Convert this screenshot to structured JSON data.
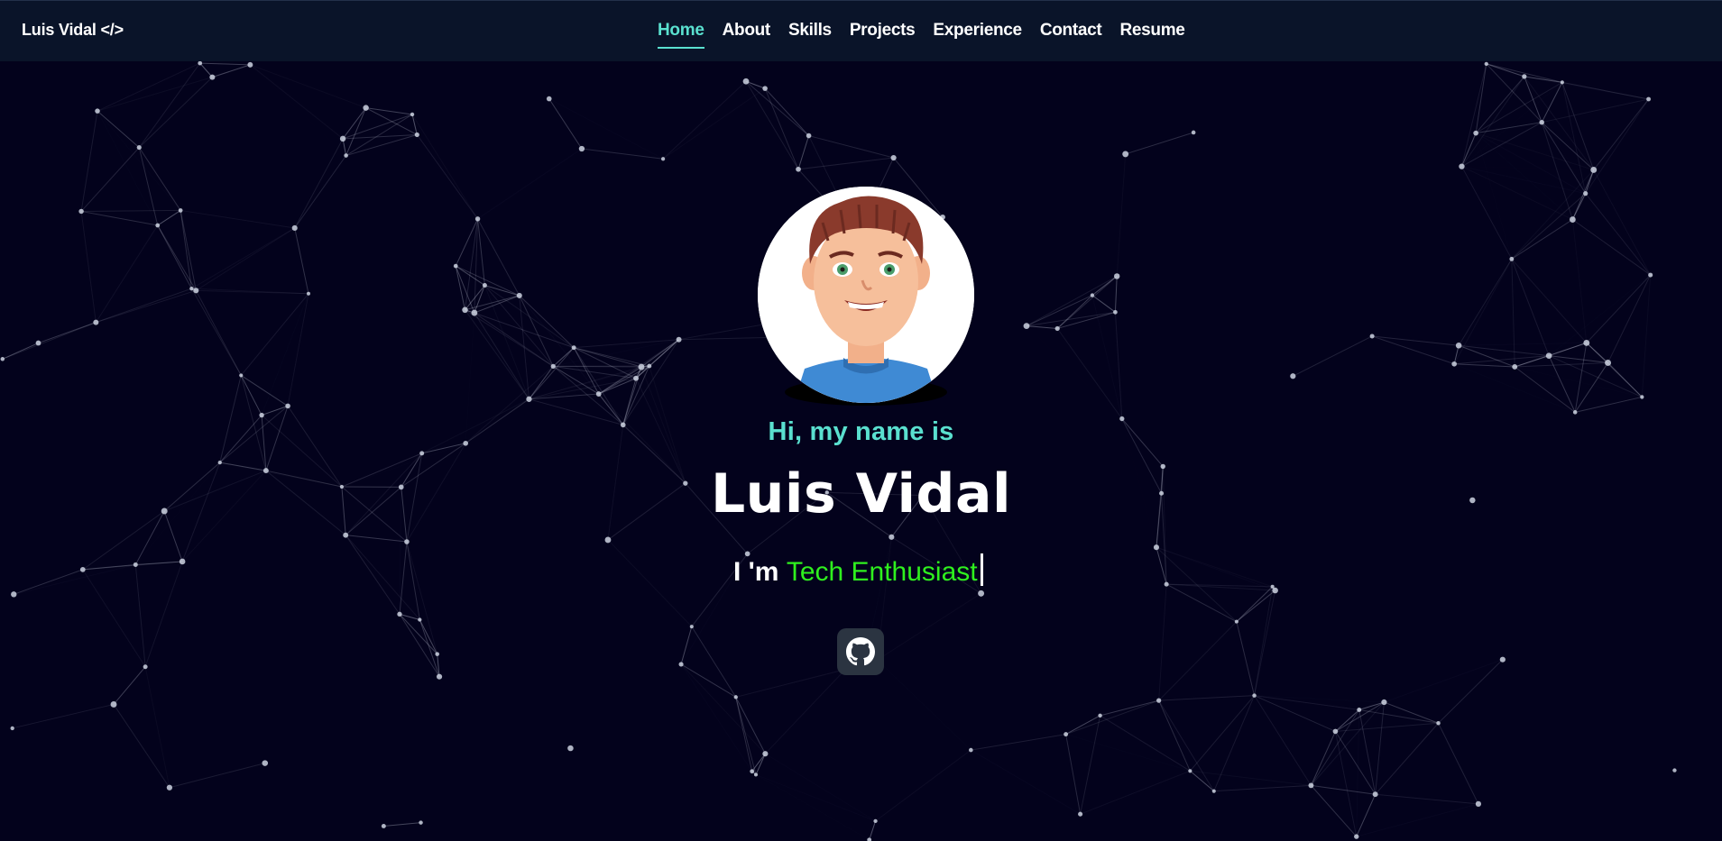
{
  "colors": {
    "background": "#03021c",
    "navbar": "#0a1429",
    "accent": "#5ae0cf",
    "role_green": "#2ff01e",
    "github_button": "#2b3441"
  },
  "navbar": {
    "brand": "Luis Vidal </>",
    "links": [
      {
        "label": "Home",
        "active": true
      },
      {
        "label": "About",
        "active": false
      },
      {
        "label": "Skills",
        "active": false
      },
      {
        "label": "Projects",
        "active": false
      },
      {
        "label": "Experience",
        "active": false
      },
      {
        "label": "Contact",
        "active": false
      },
      {
        "label": "Resume",
        "active": false
      }
    ]
  },
  "hero": {
    "avatar_icon": "cartoon-avatar",
    "greeting": "Hi, my name is",
    "name": "Luis Vidal",
    "tagline_prefix": "I 'm ",
    "tagline_role": "Tech Enthusiast",
    "socials": [
      {
        "icon": "github-icon"
      }
    ]
  }
}
